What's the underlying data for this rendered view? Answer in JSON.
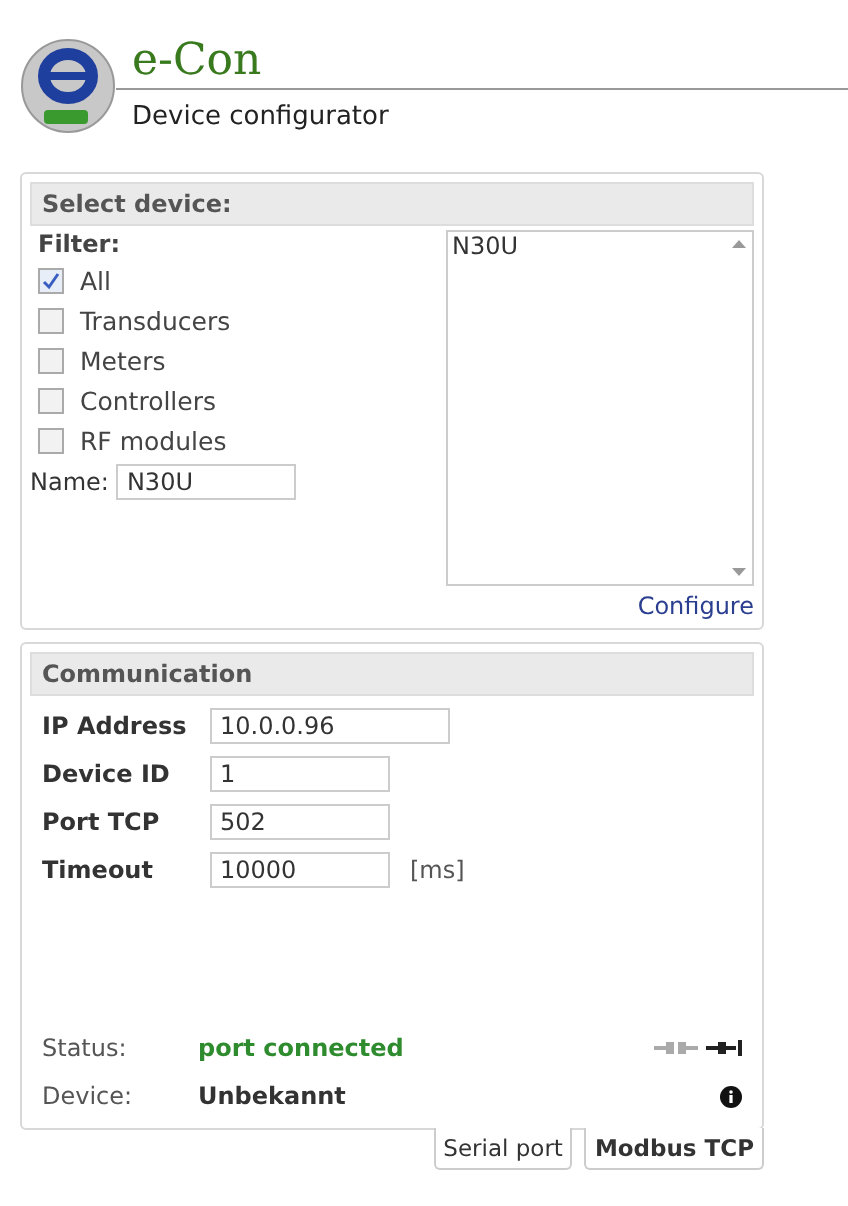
{
  "header": {
    "title": "e-Con",
    "subtitle": "Device configurator"
  },
  "select_device": {
    "title": "Select device:",
    "filter_label": "Filter:",
    "filters": [
      {
        "label": "All",
        "checked": true
      },
      {
        "label": "Transducers",
        "checked": false
      },
      {
        "label": "Meters",
        "checked": false
      },
      {
        "label": "Controllers",
        "checked": false
      },
      {
        "label": "RF modules",
        "checked": false
      }
    ],
    "name_label": "Name:",
    "name_value": "N30U",
    "device_list": [
      {
        "label": "N30U",
        "selected": false
      }
    ],
    "configure_link": "Configure"
  },
  "communication": {
    "title": "Communication",
    "fields": [
      {
        "label": "IP Address",
        "value": "10.0.0.96",
        "wide": true
      },
      {
        "label": "Device ID",
        "value": "1",
        "wide": false
      },
      {
        "label": "Port TCP",
        "value": "502",
        "wide": false
      },
      {
        "label": "Timeout",
        "value": "10000",
        "wide": false,
        "unit": "[ms]"
      }
    ],
    "status_label": "Status:",
    "status_value": "port connected",
    "connected": true,
    "device_label": "Device:",
    "device_value": "Unbekannt"
  },
  "tabs": [
    {
      "label": "Serial port",
      "selected": false
    },
    {
      "label": "Modbus TCP",
      "selected": true
    }
  ]
}
